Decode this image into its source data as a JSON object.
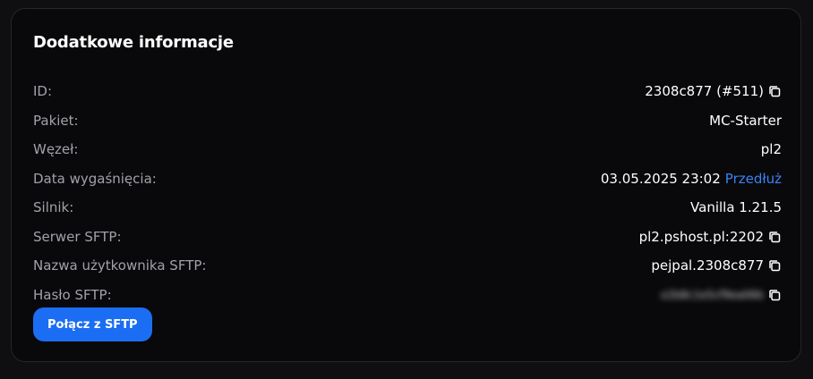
{
  "card": {
    "title": "Dodatkowe informacje",
    "connect_button": "Połącz z SFTP"
  },
  "info_rows": [
    {
      "label": "ID:",
      "value": "2308c877 (#511)",
      "copy": true
    },
    {
      "label": "Pakiet:",
      "value": "MC-Starter"
    },
    {
      "label": "Węzeł:",
      "value": "pl2"
    },
    {
      "label": "Data wygaśnięcia:",
      "value": "03.05.2025 23:02",
      "link": "Przedłuż"
    },
    {
      "label": "Silnik:",
      "value": "Vanilla 1.21.5"
    },
    {
      "label": "Serwer SFTP:",
      "value": "pl2.pshost.pl:2202",
      "copy": true
    },
    {
      "label": "Nazwa użytkownika SFTP:",
      "value": "pejpal.2308c877",
      "copy": true
    },
    {
      "label": "Hasło SFTP:",
      "value": "x2b8c1e5cf9ea06b",
      "blurred": true,
      "copy": true
    }
  ],
  "colors": {
    "accent": "#1b6ef3",
    "link": "#3b82f6",
    "background": "#09090b",
    "muted_text": "#a1a1aa"
  },
  "icons": {
    "copy": "copy-icon"
  }
}
